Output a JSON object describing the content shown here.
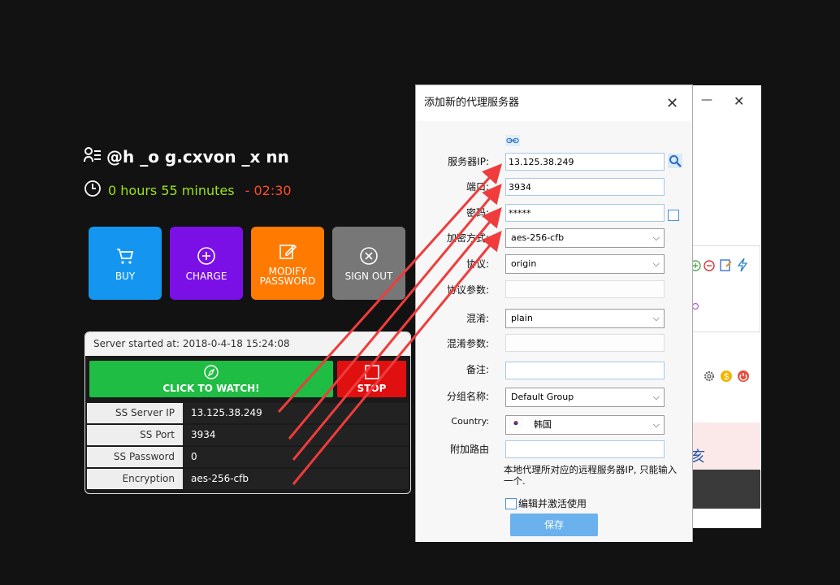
{
  "user": {
    "name": "@h _o g.cxvon _x nn"
  },
  "session": {
    "elapsed": "0 hours 55 minutes",
    "separator": " - ",
    "remaining": "02:30"
  },
  "actions": [
    {
      "label": "BUY",
      "color": "#1496f0"
    },
    {
      "label": "CHARGE",
      "color": "#7b10e6"
    },
    {
      "label": "MODIFY PASSWORD",
      "color": "#ff7a00"
    },
    {
      "label": "SIGN OUT",
      "color": "#777777"
    }
  ],
  "server": {
    "started_label": "Server started at: 2018-0-4-18 15:24:08",
    "watch_label": "CLICK TO WATCH!",
    "stop_label": "STOP",
    "rows": [
      {
        "key": "SS Server IP",
        "value": "13.125.38.249"
      },
      {
        "key": "SS Port",
        "value": "3934"
      },
      {
        "key": "SS Password",
        "value": "0"
      },
      {
        "key": "Encryption",
        "value": "aes-256-cfb"
      }
    ]
  },
  "dialog": {
    "title": "添加新的代理服务器",
    "close": "✕",
    "fields": {
      "server_ip": {
        "label": "服务器IP:",
        "value": "13.125.38.249"
      },
      "port": {
        "label": "端口:",
        "value": "3934"
      },
      "password": {
        "label": "密码:",
        "value": "*****"
      },
      "encryption": {
        "label": "加密方式:",
        "value": "aes-256-cfb"
      },
      "protocol": {
        "label": "协议:",
        "value": "origin"
      },
      "protocol_param": {
        "label": "协议参数:",
        "value": ""
      },
      "obfs": {
        "label": "混淆:",
        "value": "plain"
      },
      "obfs_param": {
        "label": "混淆参数:",
        "value": ""
      },
      "remark": {
        "label": "备注:",
        "value": ""
      },
      "group": {
        "label": "分组名称:",
        "value": "Default Group"
      },
      "country": {
        "label": "Country:",
        "value": "韩国"
      },
      "extra_route": {
        "label": "附加路由",
        "value": ""
      }
    },
    "hint": "本地代理所对应的远程服务器IP, 只能输入一个.",
    "activate_label": "编辑并激活使用",
    "save_label": "保存"
  },
  "bg_window": {
    "minimize": "—",
    "close": "✕",
    "partial_text": "亥"
  },
  "colors": {
    "arrow": "#f03c3c",
    "accent_green": "#9be21c",
    "accent_red": "#ff4b2b"
  }
}
